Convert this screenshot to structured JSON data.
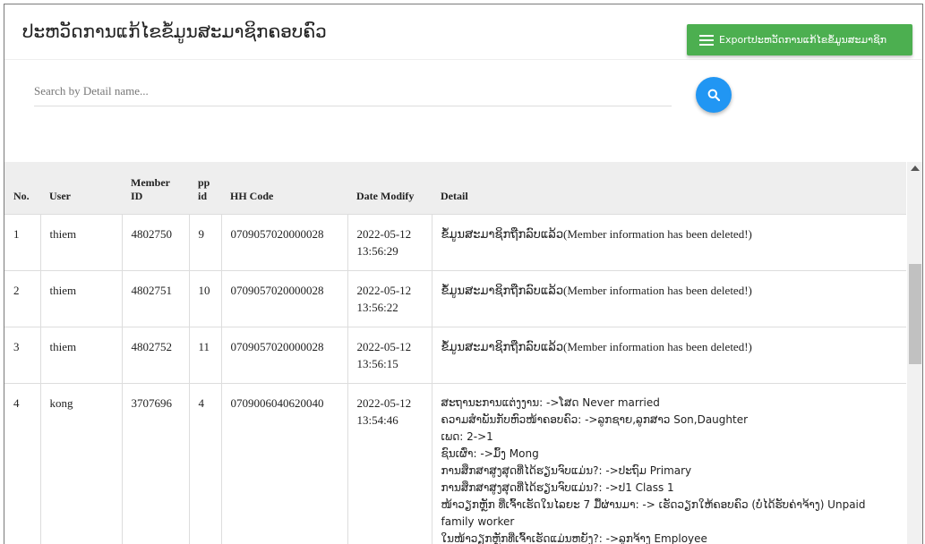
{
  "header": {
    "title": "ປະຫວັດການແກ້ໄຂຂໍ້ມູນສະມາຊິກຄອບຄົວ",
    "export_label": "Exportປະຫວັດການແກ້ໄຂຂໍ້ມູນສະມາຊິກ"
  },
  "search": {
    "placeholder": "Search by Detail name...",
    "value": ""
  },
  "table": {
    "headers": {
      "no": "No.",
      "user": "User",
      "member_id": "Member ID",
      "pp_id": "pp id",
      "hh_code": "HH Code",
      "date_modify": "Date Modify",
      "detail": "Detail"
    },
    "rows": [
      {
        "no": "1",
        "user": "thiem",
        "member_id": "4802750",
        "pp_id": "9",
        "hh_code": "0709057020000028",
        "date": "2022-05-12",
        "time": "13:56:29",
        "detail_lao": "ຂໍ້ມູນສະມາຊິກຖືກລົບແລ້ວ",
        "detail_en": "(Member information has been deleted!)"
      },
      {
        "no": "2",
        "user": "thiem",
        "member_id": "4802751",
        "pp_id": "10",
        "hh_code": "0709057020000028",
        "date": "2022-05-12",
        "time": "13:56:22",
        "detail_lao": "ຂໍ້ມູນສະມາຊິກຖືກລົບແລ້ວ",
        "detail_en": "(Member information has been deleted!)"
      },
      {
        "no": "3",
        "user": "thiem",
        "member_id": "4802752",
        "pp_id": "11",
        "hh_code": "0709057020000028",
        "date": "2022-05-12",
        "time": "13:56:15",
        "detail_lao": "ຂໍ້ມູນສະມາຊິກຖືກລົບແລ້ວ",
        "detail_en": "(Member information has been deleted!)"
      },
      {
        "no": "4",
        "user": "kong",
        "member_id": "3707696",
        "pp_id": "4",
        "hh_code": "0709006040620040",
        "date": "2022-05-12",
        "time": "13:54:46",
        "detail_lines": [
          "ສະຖານະການແຕ່ງງານ: ->ໂສດ Never married",
          "ຄວາມສຳພັນກັບຫົວໜ້າຄອບຄົວ: ->ລູກຊາຍ,ລູກສາວ Son,Daughter",
          "ເພດ: 2->1",
          "ຊົນເຜົ່າ: ->ມົ້ງ Mong",
          "ການສຶກສາສູງສຸດທີ່ໄດ້ຮຽນຈົບແມ່ນ?: ->ປະຖົມ Primary",
          "ການສຶກສາສູງສຸດທີ່ໄດ້ຮຽນຈົບແມ່ນ?: ->ປ1 Class 1",
          "ໜ້າວຽກຫຼັກ ທີ່ເຈົ້າເຮັດໃນໄລຍະ 7 ມື້ຜ່ານມາ: -> ເຮັດວຽກໃຫ້ຄອບຄົວ (ບໍ່ໄດ້ຮັບຄ່າຈ້າງ) Unpaid family worker",
          "ໃນໜ້າວຽກຫຼັກທີ່ເຈົ້າເຮັດແມ່ນຫຍັງ?: ->ລູກຈ້າງ Employee"
        ]
      }
    ]
  },
  "colors": {
    "export_button": "#4caf50",
    "search_button": "#2196f3",
    "header_row": "#eeeeee"
  },
  "icons": {
    "export": "menu-icon",
    "search": "search-icon"
  }
}
